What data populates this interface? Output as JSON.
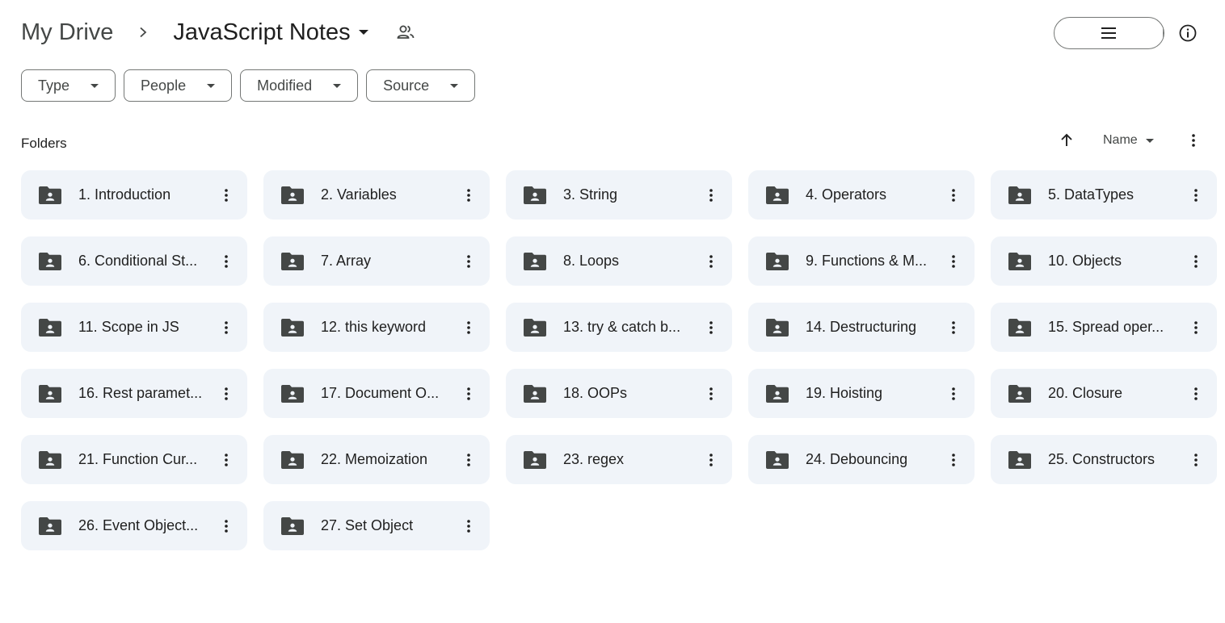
{
  "breadcrumb": {
    "root": "My Drive",
    "current": "JavaScript Notes",
    "separator_icon": "chevron-right-icon",
    "shared_icon": "people-icon"
  },
  "view_toggle": {
    "list_icon": "list-view-icon",
    "grid_icon": "grid-view-icon",
    "selected": "grid",
    "selected_color": "#c2e7ff"
  },
  "info_icon": "info-icon",
  "filters": [
    {
      "label": "Type"
    },
    {
      "label": "People"
    },
    {
      "label": "Modified"
    },
    {
      "label": "Source"
    }
  ],
  "section": {
    "title": "Folders",
    "sort_direction_icon": "arrow-up-icon",
    "sort_label": "Name",
    "more_icon": "more-vertical-icon"
  },
  "folders": [
    {
      "name": "1. Introduction"
    },
    {
      "name": "2. Variables"
    },
    {
      "name": "3. String"
    },
    {
      "name": "4. Operators"
    },
    {
      "name": "5. DataTypes"
    },
    {
      "name": "6. Conditional St..."
    },
    {
      "name": "7. Array"
    },
    {
      "name": "8. Loops"
    },
    {
      "name": "9. Functions & M..."
    },
    {
      "name": "10. Objects"
    },
    {
      "name": "11. Scope in JS"
    },
    {
      "name": "12. this keyword"
    },
    {
      "name": "13. try & catch b..."
    },
    {
      "name": "14. Destructuring"
    },
    {
      "name": "15. Spread oper..."
    },
    {
      "name": "16. Rest paramet..."
    },
    {
      "name": "17. Document O..."
    },
    {
      "name": "18. OOPs"
    },
    {
      "name": "19. Hoisting"
    },
    {
      "name": "20. Closure"
    },
    {
      "name": "21. Function Cur..."
    },
    {
      "name": "22. Memoization"
    },
    {
      "name": "23. regex"
    },
    {
      "name": "24. Debouncing"
    },
    {
      "name": "25. Constructors"
    },
    {
      "name": "26. Event Object..."
    },
    {
      "name": "27. Set Object"
    }
  ],
  "colors": {
    "folder_bg": "#f0f4f9",
    "icon": "#444746",
    "text": "#1f1f1f"
  }
}
